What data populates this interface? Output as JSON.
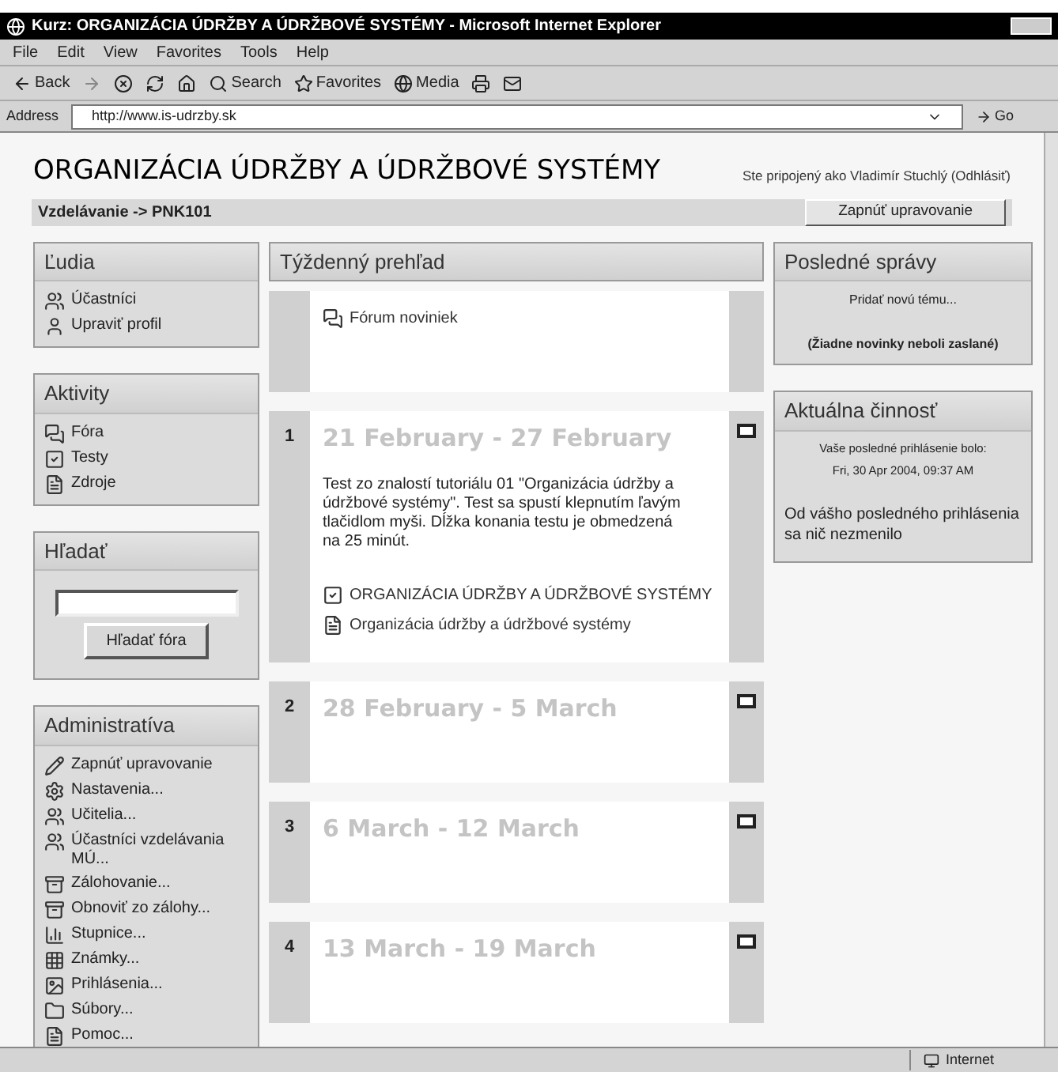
{
  "window": {
    "title": "Kurz: ORGANIZÁCIA ÚDRŽBY A ÚDRŽBOVÉ SYSTÉMY - Microsoft Internet Explorer"
  },
  "menu": [
    "File",
    "Edit",
    "View",
    "Favorites",
    "Tools",
    "Help"
  ],
  "toolbar": {
    "back": "Back",
    "search": "Search",
    "favorites": "Favorites",
    "media": "Media"
  },
  "address": {
    "label": "Address",
    "value": "http://www.is-udrzby.sk",
    "go": "Go"
  },
  "page": {
    "title": "ORGANIZÁCIA ÚDRŽBY A ÚDRŽBOVÉ SYSTÉMY",
    "login": "Ste pripojený ako Vladimír Stuchlý (Odhlásiť)",
    "breadcrumb": "Vzdelávanie -> PNK101",
    "edit_button": "Zapnúť upravovanie"
  },
  "left_blocks": [
    {
      "kind": "list",
      "title": "Ľudia",
      "items": [
        {
          "label": "Účastníci",
          "kind": "people"
        },
        {
          "label": "Upraviť profil",
          "kind": "user"
        }
      ]
    },
    {
      "kind": "list",
      "title": "Aktivity",
      "items": [
        {
          "label": "Fóra",
          "kind": "forum"
        },
        {
          "label": "Testy",
          "kind": "quiz"
        },
        {
          "label": "Zdroje",
          "kind": "file"
        }
      ]
    },
    {
      "kind": "search",
      "title": "Hľadať",
      "button": "Hľadať fóra"
    },
    {
      "kind": "list",
      "title": "Administratíva",
      "items": [
        {
          "label": "Zapnúť upravovanie",
          "kind": "edit"
        },
        {
          "label": "Nastavenia...",
          "kind": "settings"
        },
        {
          "label": "Učitelia...",
          "kind": "people"
        },
        {
          "label": "Účastníci vzdelávania MÚ...",
          "kind": "people"
        },
        {
          "label": "Zálohovanie...",
          "kind": "backup"
        },
        {
          "label": "Obnoviť zo zálohy...",
          "kind": "backup"
        },
        {
          "label": "Stupnice...",
          "kind": "chart"
        },
        {
          "label": "Známky...",
          "kind": "grid"
        },
        {
          "label": "Prihlásenia...",
          "kind": "image"
        },
        {
          "label": "Súbory...",
          "kind": "folder"
        },
        {
          "label": "Pomoc...",
          "kind": "file"
        }
      ]
    }
  ],
  "weekly": {
    "title": "Týždenný prehľad",
    "sections": [
      {
        "items": [
          {
            "label": "Fórum noviniek",
            "kind": "forum"
          }
        ],
        "has_toggle": false
      },
      {
        "number": "1",
        "title": "21 February - 27 February",
        "summary": "Test zo znalostí tutoriálu 01 \"Organizácia údržby a údržbové systémy\". Test sa spustí klepnutím ľavým tlačidlom myši. Dĺžka konania testu je obmedzená na 25 minút.",
        "items": [
          {
            "label": "ORGANIZÁCIA ÚDRŽBY A ÚDRŽBOVÉ SYSTÉMY",
            "kind": "quiz"
          },
          {
            "label": "Organizácia údržby a údržbové systémy",
            "kind": "file"
          }
        ],
        "has_toggle": true
      },
      {
        "number": "2",
        "title": "28 February - 5 March",
        "has_toggle": true
      },
      {
        "number": "3",
        "title": "6 March - 12 March",
        "has_toggle": true
      },
      {
        "number": "4",
        "title": "13 March - 19 March",
        "has_toggle": true
      }
    ]
  },
  "right_blocks": [
    {
      "title": "Posledné správy",
      "lines": [
        {
          "text": "Pridať novú tému...",
          "kind": "link"
        },
        {
          "text": "(Žiadne novinky neboli zaslané)",
          "kind": "bold"
        }
      ]
    },
    {
      "title": "Aktuálna činnosť",
      "lines": [
        {
          "text": "Vaše posledné prihlásenie bolo:",
          "kind": "small"
        },
        {
          "text": "Fri, 30 Apr 2004, 09:37 AM",
          "kind": "small"
        },
        {
          "text": "Od vášho posledného prihlásenia sa nič nezmenilo",
          "kind": "normal"
        }
      ]
    }
  ],
  "status_bar": {
    "zone": "Internet"
  }
}
